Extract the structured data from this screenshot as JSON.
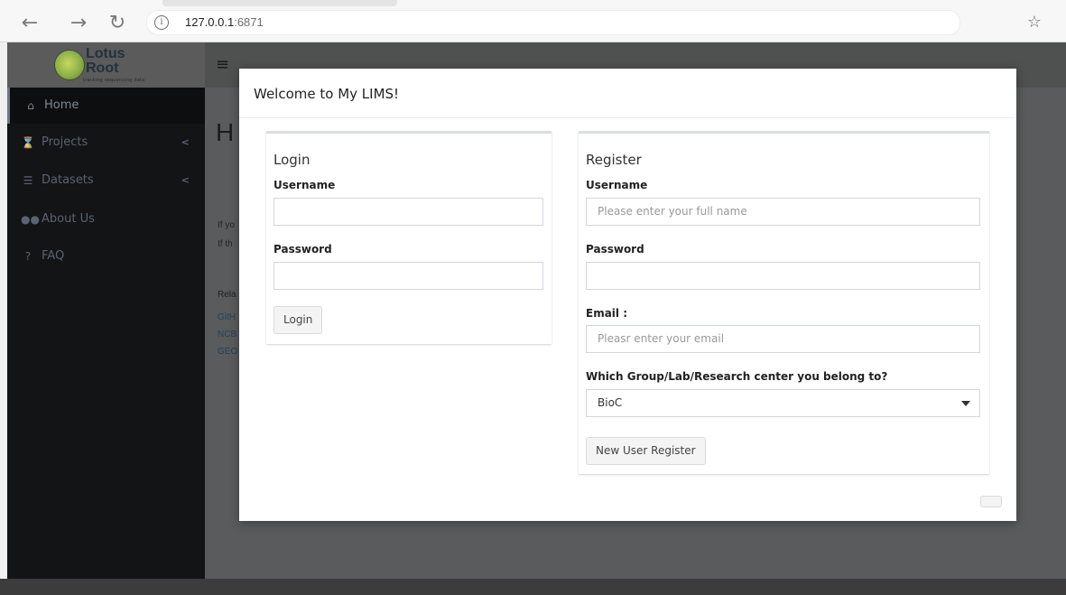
{
  "browser": {
    "url_host": "127.0.0.1",
    "url_port": ":6871"
  },
  "sidebar": {
    "logo_line1": "Lotus",
    "logo_line2": "Root",
    "logo_tagline": "tracking sequencing data",
    "items": [
      {
        "label": "Home",
        "icon": "home-icon"
      },
      {
        "label": "Projects",
        "icon": "hourglass-icon"
      },
      {
        "label": "Datasets",
        "icon": "database-icon"
      },
      {
        "label": "About Us",
        "icon": "users-icon"
      },
      {
        "label": "FAQ",
        "icon": "question-circle-icon"
      }
    ]
  },
  "background": {
    "heading": "H",
    "text1": "If yo",
    "text2": "If th",
    "related": "Rela",
    "link1": "GitH",
    "link2": "NCB",
    "link3": "GEO"
  },
  "modal": {
    "title": "Welcome to My LIMS!",
    "login": {
      "title": "Login",
      "username_label": "Username",
      "password_label": "Password",
      "button": "Login"
    },
    "register": {
      "title": "Register",
      "username_label": "Username",
      "username_placeholder": "Please enter your full name",
      "password_label": "Password",
      "email_label": "Email :",
      "email_placeholder": "Pleasr enter your email",
      "group_label": "Which Group/Lab/Research center you belong to?",
      "group_selected": "BioC",
      "button": "New User Register"
    }
  }
}
